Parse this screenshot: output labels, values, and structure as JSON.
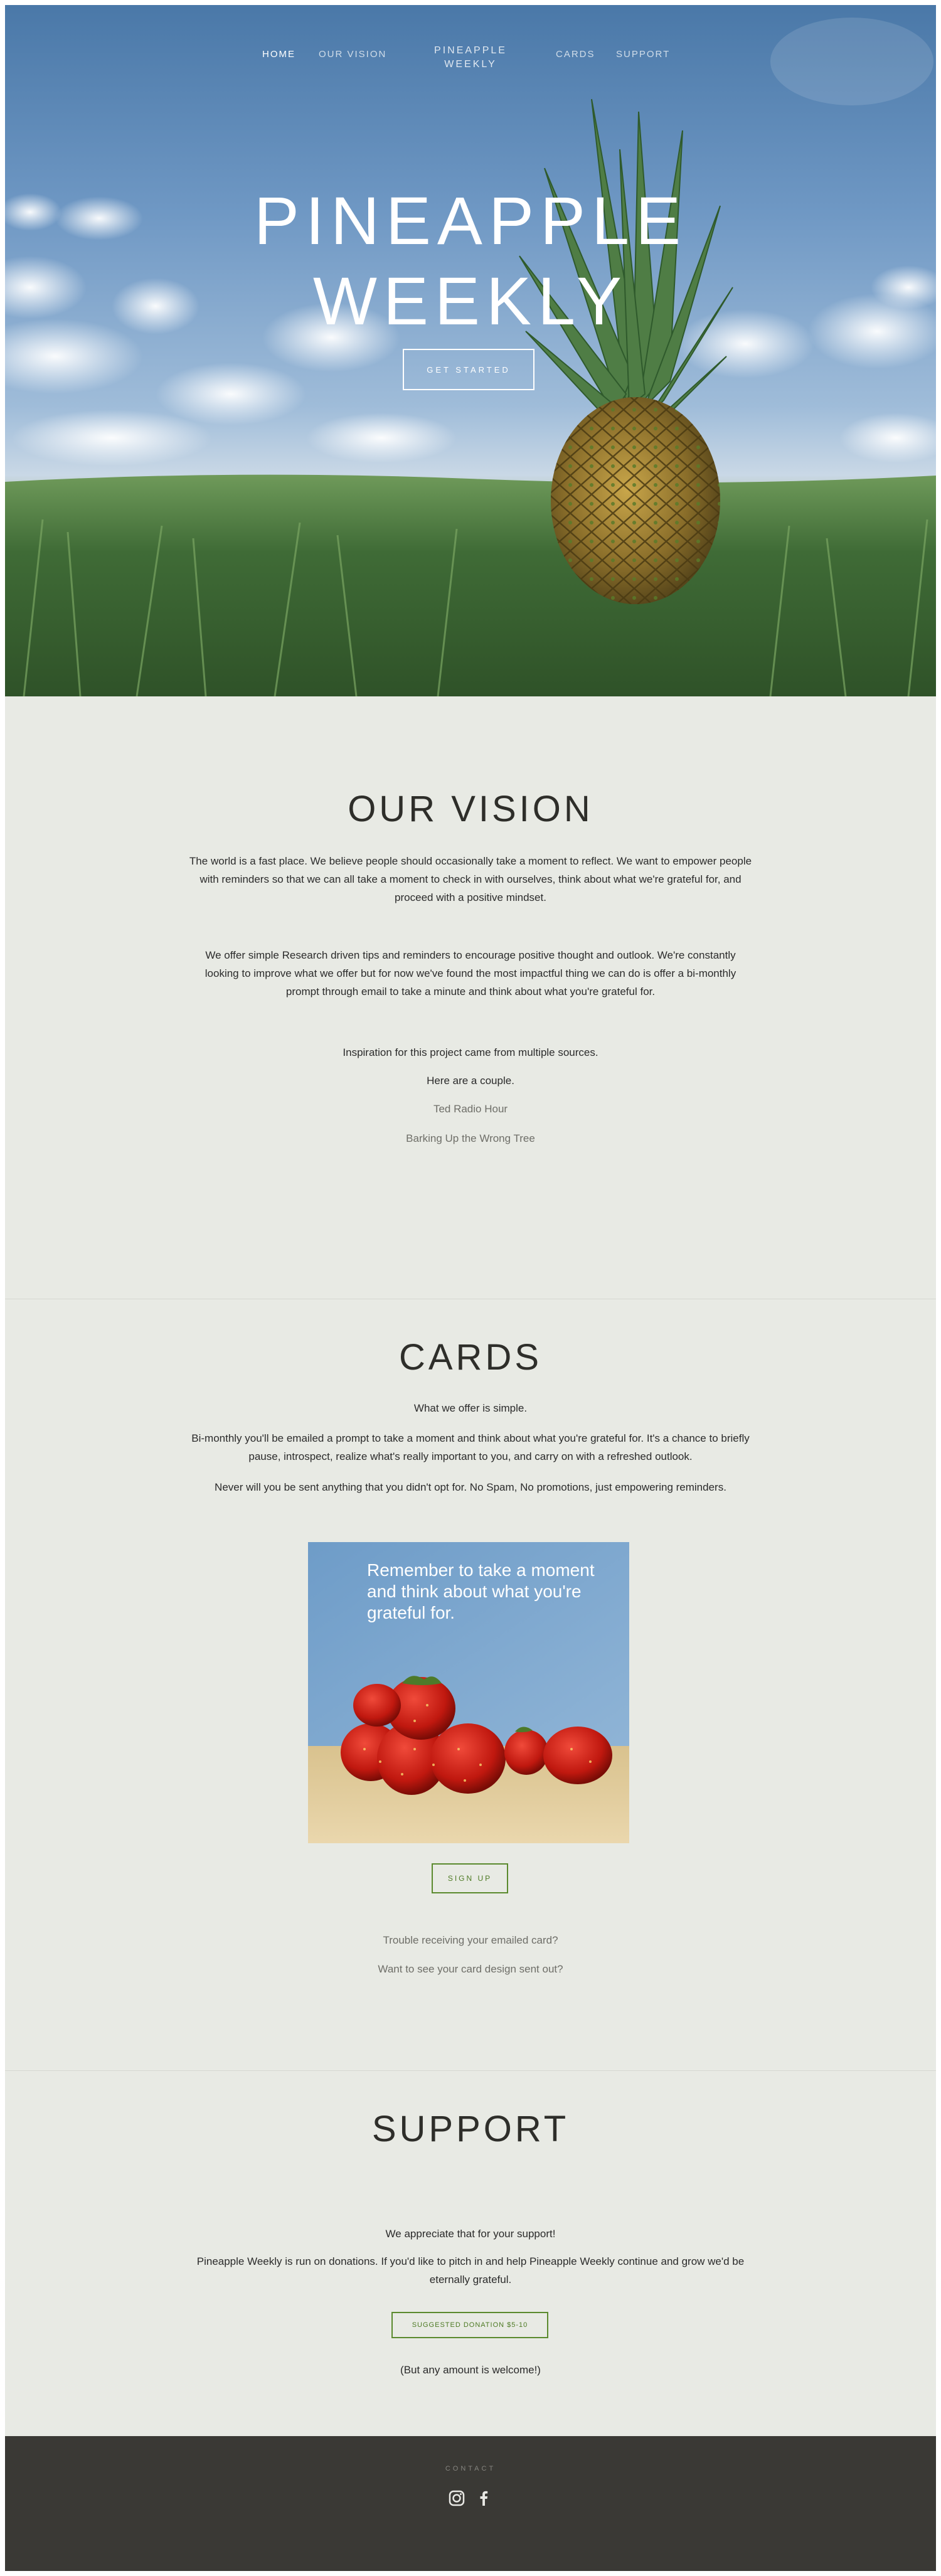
{
  "nav": {
    "home": "HOME",
    "our_vision": "OUR VISION",
    "brand_line1": "PINEAPPLE",
    "brand_line2": "WEEKLY",
    "cards": "CARDS",
    "support": "SUPPORT"
  },
  "hero": {
    "title_line1": "PINEAPPLE",
    "title_line2": "WEEKLY",
    "cta": "GET STARTED"
  },
  "vision": {
    "title": "OUR VISION",
    "para1": "The world is a fast place. We believe people should occasionally take a moment to reflect. We want to empower people with reminders so that we can all take a moment to check in with ourselves, think about what we're grateful for, and proceed with a positive mindset.",
    "para2": "We offer simple Research driven tips and reminders to encourage positive thought and outlook. We're constantly looking to improve what we offer but for now we've found the most impactful thing we can do is offer a bi-monthly prompt through email to take a minute and think about what you're grateful for.",
    "inspiration": "Inspiration for this project came from multiple sources.",
    "couple": "Here are a couple.",
    "link1": "Ted Radio Hour",
    "link2": "Barking Up the Wrong Tree"
  },
  "cards": {
    "title": "CARDS",
    "intro": "What we offer is simple.",
    "para1": "Bi-monthly you'll be emailed a prompt to take a moment and think about what you're grateful for. It's a chance to briefly pause, introspect, realize what's really important to you, and carry on with a refreshed outlook.",
    "para2": "Never will you be sent anything that you didn't opt for. No Spam, No promotions, just empowering reminders.",
    "image_text": "Remember to take a moment and think about what you're grateful for.",
    "signup": "SIGN UP",
    "link1": "Trouble receiving your emailed card?",
    "link2": "Want to see your card design sent out?"
  },
  "support": {
    "title": "SUPPORT",
    "thanks": "We appreciate that for your support!",
    "para": "Pineapple Weekly is run on donations. If you'd like to pitch in and help Pineapple Weekly continue and grow we'd be eternally grateful.",
    "donate": "SUGGESTED DONATION $5-10",
    "note": "(But any amount is welcome!)"
  },
  "footer": {
    "contact": "CONTACT",
    "icons": [
      "instagram-icon",
      "facebook-icon"
    ]
  },
  "colors": {
    "background": "#e8eae4",
    "accent_green": "#5b8a2e",
    "footer": "#3a3935"
  }
}
